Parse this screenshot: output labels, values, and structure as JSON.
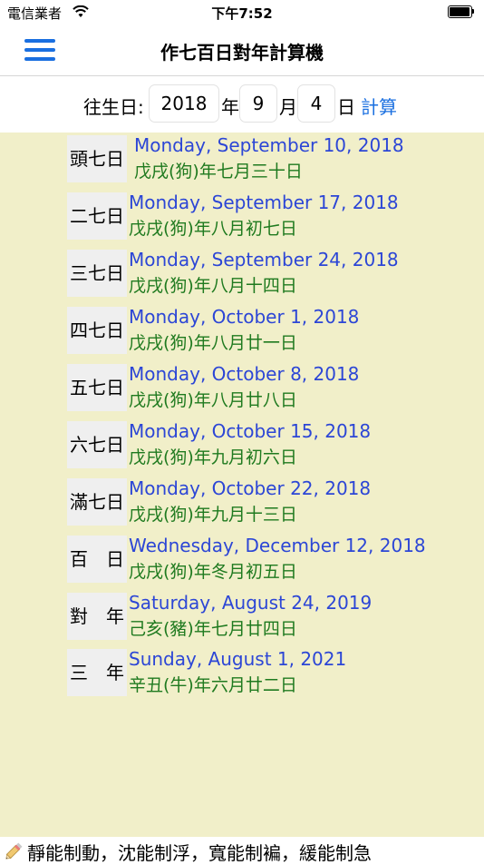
{
  "status_bar": {
    "carrier": "電信業者",
    "time": "下午7:52"
  },
  "nav": {
    "title": "作七百日對年計算機",
    "menu_icon": "hamburger-menu-icon"
  },
  "input": {
    "birth_label": "往生日:",
    "year_value": "2018",
    "year_unit": "年",
    "month_value": "9",
    "month_unit": "月",
    "day_value": "4",
    "day_unit": "日",
    "calc_label": "計算"
  },
  "results": [
    {
      "label": "頭七日",
      "date": "Monday, September 10, 2018",
      "lunar": "戊戌(狗)年七月三十日"
    },
    {
      "label": "二七日",
      "date": "Monday, September 17, 2018",
      "lunar": "戊戌(狗)年八月初七日"
    },
    {
      "label": "三七日",
      "date": "Monday, September 24, 2018",
      "lunar": "戊戌(狗)年八月十四日"
    },
    {
      "label": "四七日",
      "date": "Monday, October 1, 2018",
      "lunar": "戊戌(狗)年八月廿一日"
    },
    {
      "label": "五七日",
      "date": "Monday, October 8, 2018",
      "lunar": "戊戌(狗)年八月廿八日"
    },
    {
      "label": "六七日",
      "date": "Monday, October 15, 2018",
      "lunar": "戊戌(狗)年九月初六日"
    },
    {
      "label": "滿七日",
      "date": "Monday, October 22, 2018",
      "lunar": "戊戌(狗)年九月十三日"
    },
    {
      "label": "百　日",
      "date": "Wednesday, December 12, 2018",
      "lunar": "戊戌(狗)年冬月初五日"
    },
    {
      "label": "對　年",
      "date": "Saturday, August 24, 2019",
      "lunar": "己亥(豬)年七月廿四日"
    },
    {
      "label": "三　年",
      "date": "Sunday, August 1, 2021",
      "lunar": "辛丑(牛)年六月廿二日"
    }
  ],
  "footer": {
    "text": "靜能制動，沈能制浮，寬能制褊，緩能制急",
    "icon": "pencil-icon"
  },
  "colors": {
    "accent": "#1a6fe0",
    "date_text": "#2c46d6",
    "lunar_text": "#1f7a1f",
    "results_bg": "#f1efc9"
  }
}
